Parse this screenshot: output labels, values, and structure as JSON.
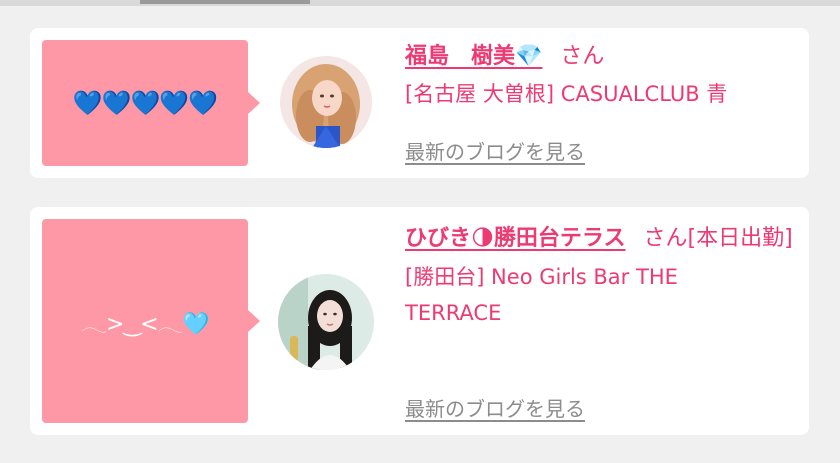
{
  "cards": [
    {
      "bubble_text": "💙💙💙💙💙",
      "name": "福島　樹美💎",
      "honorific": "さん",
      "status": "",
      "shop": "[名古屋 大曽根] CASUALCLUB 青",
      "blog_link": "最新のブログを見る"
    },
    {
      "bubble_text": "𓂃>‿<𓂃🩵",
      "name": "ひびき🌗勝田台テラス",
      "honorific": "さん",
      "status": "[本日出勤]",
      "shop": "[勝田台] Neo Girls Bar THE TERRACE",
      "blog_link": "最新のブログを見る"
    }
  ],
  "colors": {
    "accent": "#ee3a73",
    "bubble": "#fe98a6",
    "link_gray": "#8c8c8c",
    "background": "#f0f0f0"
  }
}
